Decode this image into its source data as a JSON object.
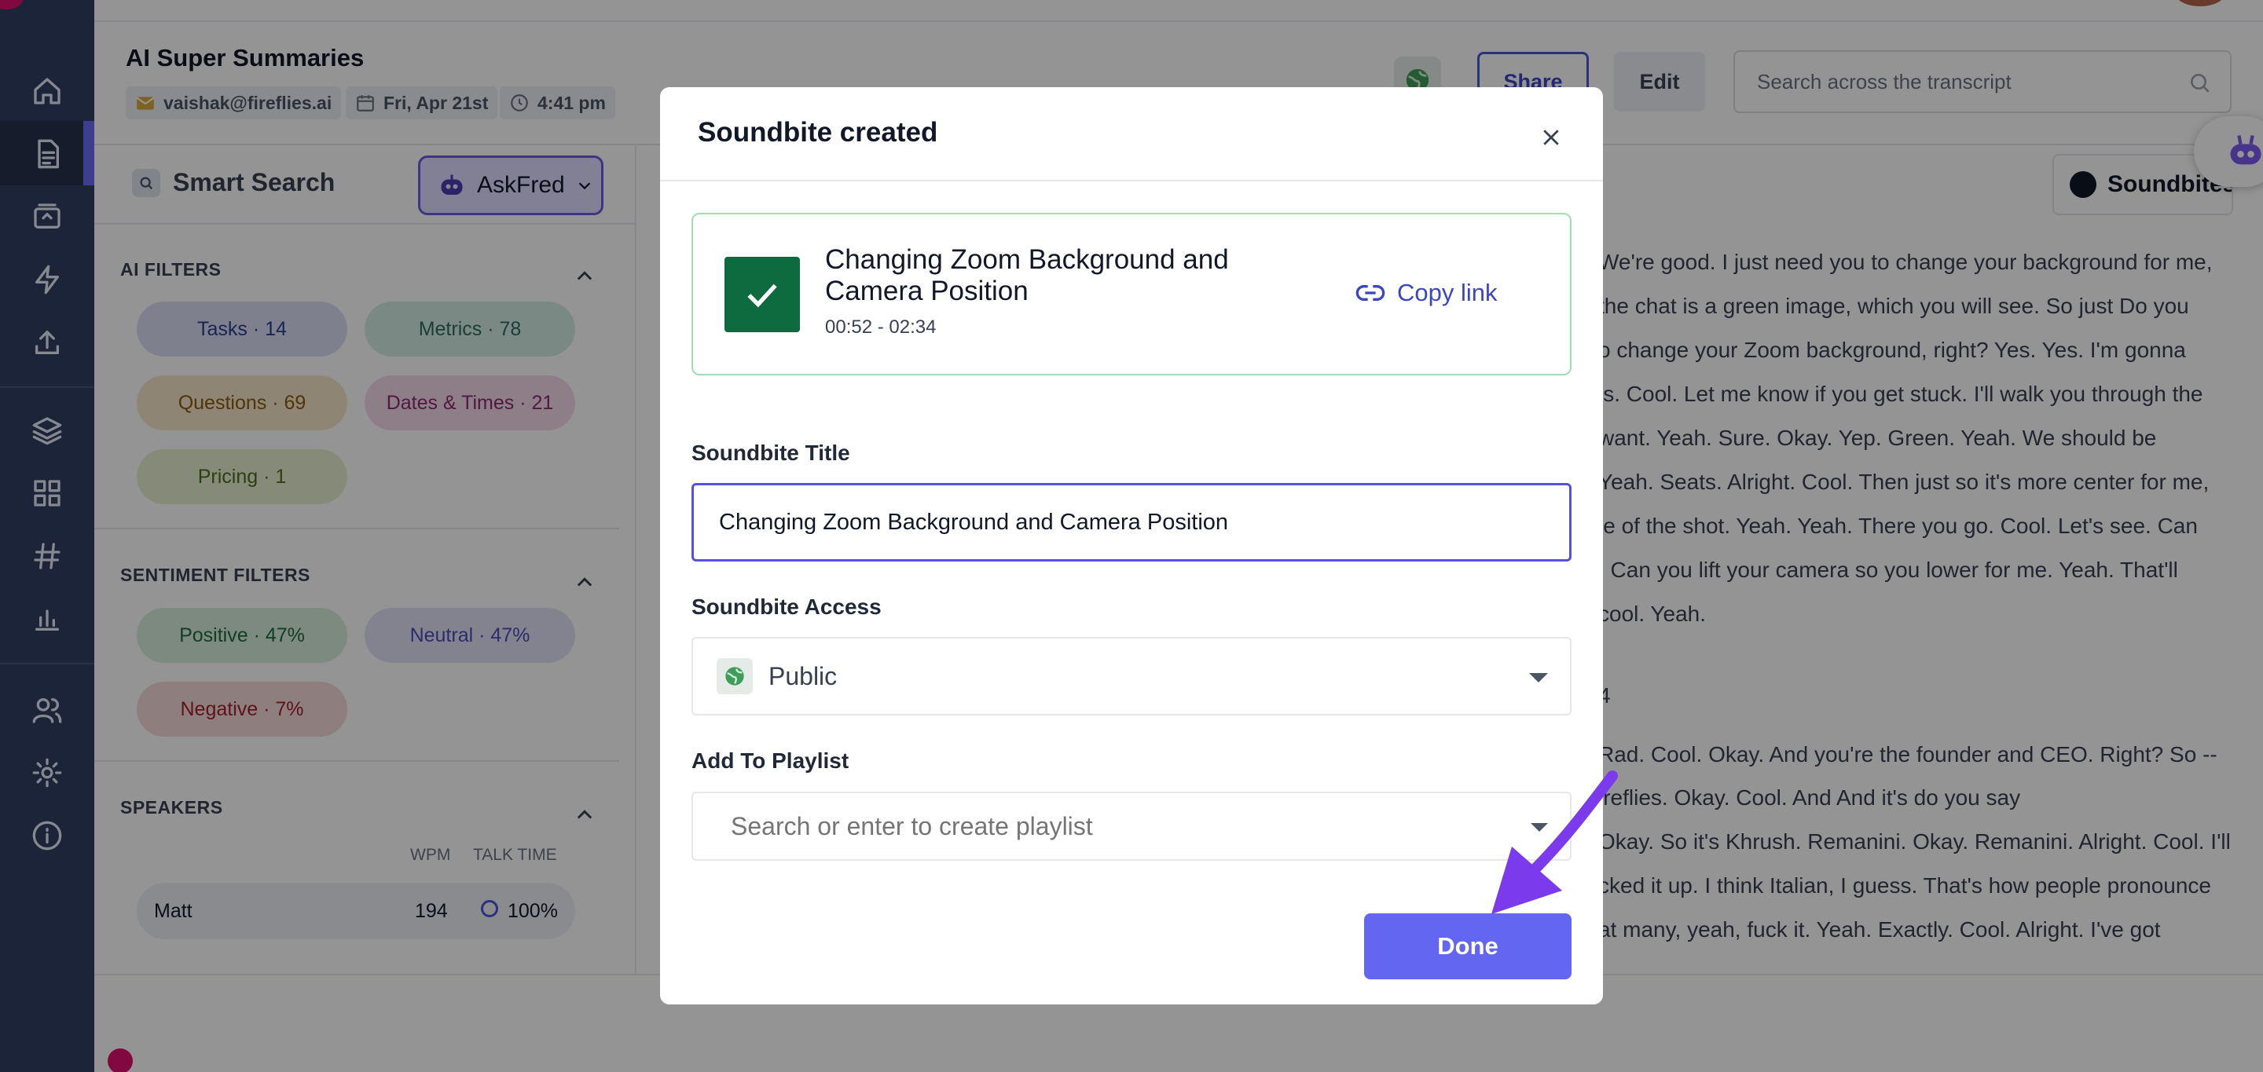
{
  "meeting": {
    "title": "AI Super Summaries",
    "organizer": "vaishak@fireflies.ai",
    "date": "Fri, Apr 21st",
    "time": "4:41 pm"
  },
  "header": {
    "share_label": "Share",
    "edit_label": "Edit",
    "search_placeholder": "Search across the transcript"
  },
  "sidebar": {
    "icons": [
      "home-icon",
      "notes-icon",
      "meetings-icon",
      "bolt-icon",
      "upload-icon",
      "layers-icon",
      "apps-icon",
      "hashtag-icon",
      "analytics-icon",
      "team-icon",
      "settings-icon",
      "info-icon"
    ]
  },
  "filters": {
    "smart_search_label": "Smart Search",
    "askfred_label": "AskFred",
    "ai_filters_title": "AI FILTERS",
    "ai_filters": [
      {
        "label": "Tasks · 14",
        "color": "#2c3f8c",
        "bg": "#d9def3"
      },
      {
        "label": "Metrics · 78",
        "color": "#2f6b5e",
        "bg": "#d4ece4"
      },
      {
        "label": "Questions · 69",
        "color": "#8a5a12",
        "bg": "#f6e6c8"
      },
      {
        "label": "Dates & Times · 21",
        "color": "#8c2c6f",
        "bg": "#f3d9ea"
      },
      {
        "label": "Pricing · 1",
        "color": "#4f6b1f",
        "bg": "#e6efcf"
      }
    ],
    "sentiment_title": "SENTIMENT FILTERS",
    "sentiment_filters": [
      {
        "label": "Positive · 47%",
        "color": "#1f6b3a",
        "bg": "#d6eedc"
      },
      {
        "label": "Neutral · 47%",
        "color": "#4b4fb8",
        "bg": "#e2e2f8"
      },
      {
        "label": "Negative · 7%",
        "color": "#a3222a",
        "bg": "#f6d9d9"
      }
    ],
    "speakers_title": "SPEAKERS",
    "speaker_cols": {
      "wpm": "WPM",
      "talk_time": "TALK TIME"
    },
    "speakers": [
      {
        "name": "Matt",
        "wpm": "194",
        "talk_time": "100%"
      }
    ]
  },
  "transcript": {
    "soundbites_label": "Soundbites",
    "lines": [
      "We're good. I just need you to change your background for me,",
      "the chat is a green image, which you will see. So just Do you",
      "o change your Zoom background, right? Yes. Yes. I'm gonna",
      "is. Cool. Let me know if you get stuck. I'll walk you through the",
      "want. Yeah. Sure. Okay. Yep. Green. Yeah. We should be",
      "Yeah. Seats. Alright. Cool. Then just so it's more center for me,",
      "le of the shot. Yeah. Yeah. There you go. Cool. Let's see. Can",
      ". Can you lift your camera so you lower for me. Yeah. That'll",
      "cool. Yeah.",
      "4",
      "Rad. Cool. Okay. And you're the founder and CEO. Right? So --",
      "ireflies. Okay. Cool. And And it's do you say",
      "Okay. So it's Khrush. Remanini. Okay. Remanini. Alright. Cool. I'll",
      "cked it up. I think Italian, I guess. That's how people pronounce",
      "at many, yeah, fuck it. Yeah. Exactly. Cool. Alright. I've got"
    ]
  },
  "modal": {
    "title": "Soundbite created",
    "soundbite_name": "Changing Zoom Background and Camera Position",
    "time_range": "00:52 - 02:34",
    "copy_link_label": "Copy link",
    "title_label": "Soundbite Title",
    "title_value": "Changing Zoom Background and Camera Position",
    "access_label": "Soundbite Access",
    "access_value": "Public",
    "playlist_label": "Add To Playlist",
    "playlist_placeholder": "Search or enter to create playlist",
    "done_label": "Done"
  },
  "colors": {
    "nav_bg": "#2f3e63",
    "accent": "#6366f1",
    "success": "#0d6b3f",
    "annotation_arrow": "#7c3aed"
  }
}
